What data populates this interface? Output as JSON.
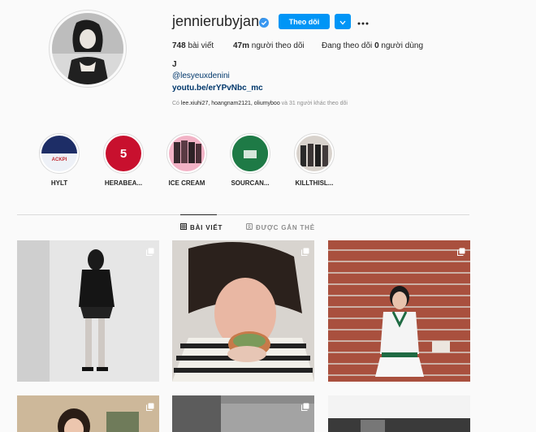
{
  "profile": {
    "username": "jennierubyjane",
    "follow_label": "Theo dõi",
    "stats": {
      "posts_count": "748",
      "posts_label": "bài viết",
      "followers_count": "47m",
      "followers_label": "người theo dõi",
      "following_prefix": "Đang theo dõi",
      "following_count": "0",
      "following_suffix": "người dùng"
    },
    "bio": {
      "name": "J",
      "handle": "@lesyeuxdenini",
      "link": "youtu.be/erYPvNbc_mc"
    },
    "followed_by": {
      "prefix": "Có",
      "users": "lee.xiuhi27, hoangnam2121, oliumyboo",
      "suffix": "và 31 người khác theo dõi"
    }
  },
  "highlights": [
    {
      "label": "HYLT",
      "badge": ""
    },
    {
      "label": "HERABEA...",
      "badge": "5"
    },
    {
      "label": "ICE CREAM",
      "badge": ""
    },
    {
      "label": "SOURCAN...",
      "badge": ""
    },
    {
      "label": "KILLTHISL...",
      "badge": ""
    }
  ],
  "tabs": {
    "posts": "BÀI VIẾT",
    "tagged": "ĐƯỢC GẮN THẺ"
  },
  "colors": {
    "accent": "#0095f6",
    "link": "#00376b",
    "muted": "#8e8e8e"
  }
}
